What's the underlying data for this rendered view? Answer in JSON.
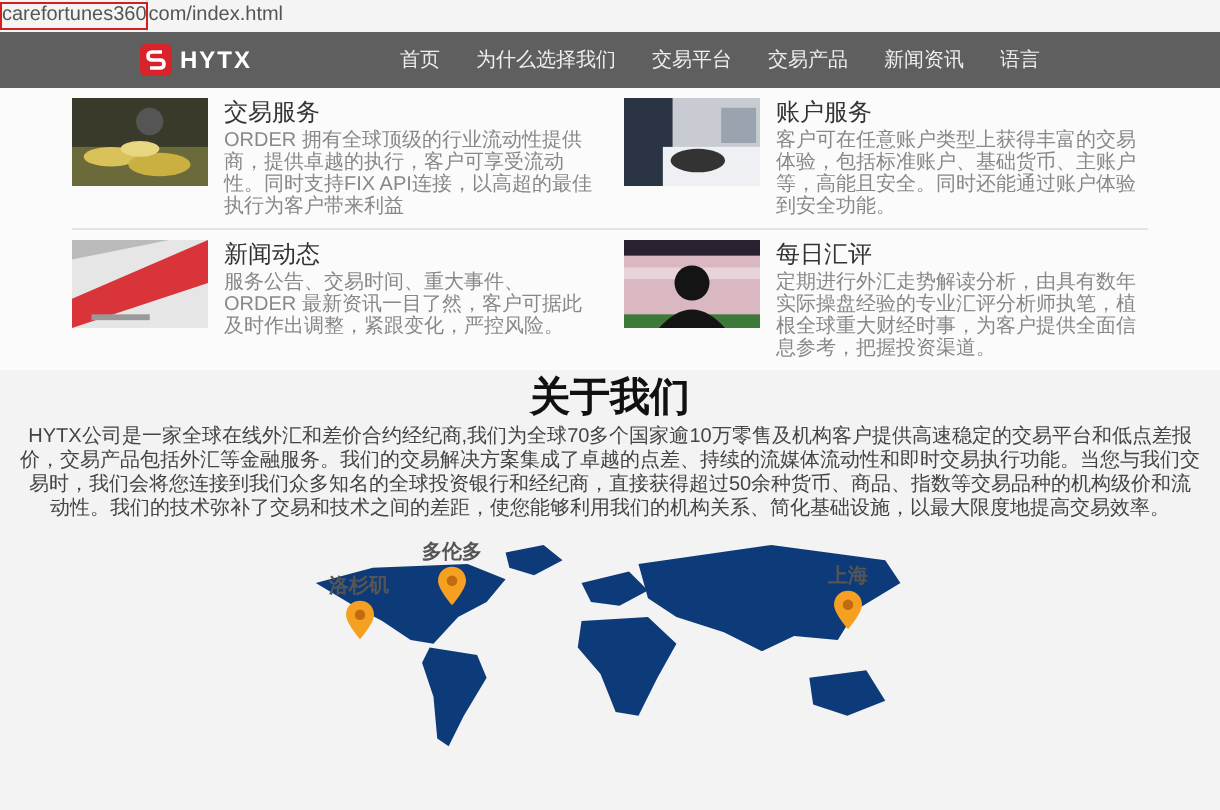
{
  "address_bar": {
    "domain": "carefortunes360",
    "path": "com/index.html"
  },
  "nav": {
    "logo": "HYTX",
    "items": [
      "首页",
      "为什么选择我们",
      "交易平台",
      "交易产品",
      "新闻资讯",
      "语言"
    ]
  },
  "services": [
    {
      "title": "交易服务",
      "description": "ORDER 拥有全球顶级的行业流动性提供商，提供卓越的执行，客户可享受流动性。同时支持FIX API连接，以高超的最佳执行为客户带来利益"
    },
    {
      "title": "账户服务",
      "description": "客户可在任意账户类型上获得丰富的交易体验，包括标准账户、基础货币、主账户等，高能且安全。同时还能通过账户体验到安全功能。"
    },
    {
      "title": "新闻动态",
      "description": "服务公告、交易时间、重大事件、ORDER 最新资讯一目了然，客户可据此及时作出调整，紧跟变化，严控风险。"
    },
    {
      "title": "每日汇评",
      "description": "定期进行外汇走势解读分析，由具有数年实际操盘经验的专业汇评分析师执笔，植根全球重大财经时事，为客户提供全面信息参考，把握投资渠道。"
    }
  ],
  "about": {
    "title": "关于我们",
    "body": "HYTX公司是一家全球在线外汇和差价合约经纪商,我们为全球70多个国家逾10万零售及机构客户提供高速稳定的交易平台和低点差报价，交易产品包括外汇等金融服务。我们的交易解决方案集成了卓越的点差、持续的流媒体流动性和即时交易执行功能。当您与我们交易时，我们会将您连接到我们众多知名的全球投资银行和经纪商，直接获得超过50余种货币、商品、指数等交易品种的机构级价和流动性。我们的技术弥补了交易和技术之间的差距，使您能够利用我们的机构关系、简化基础设施，以最大限度地提高交易效率。",
    "pins": [
      {
        "label": "洛杉矶"
      },
      {
        "label": "多伦多"
      },
      {
        "label": "上海"
      }
    ]
  }
}
